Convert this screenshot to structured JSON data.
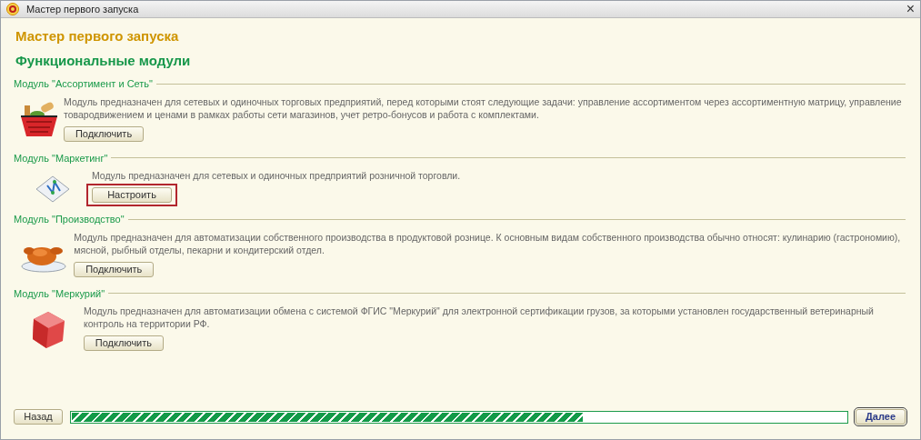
{
  "window": {
    "title": "Мастер первого запуска",
    "close": "×"
  },
  "heading": "Мастер первого запуска",
  "subheading": "Функциональные модули",
  "modules": [
    {
      "title": "Модуль \"Ассортимент и Сеть\"",
      "kind": "basket",
      "description": "Модуль предназначен для сетевых и одиночных торговых предприятий, перед которыми стоят следующие задачи: управление ассортиментом через ассортиментную матрицу, управление товародвижением и ценами в рамках работы сети магазинов, учет ретро-бонусов и работа с комплектами.",
      "button": "Подключить",
      "highlighted": false
    },
    {
      "title": "Модуль \"Маркетинг\"",
      "kind": "diagram",
      "description": "Модуль предназначен для сетевых и одиночных предприятий розничной торговли.",
      "button": "Настроить",
      "highlighted": true
    },
    {
      "title": "Модуль \"Производство\"",
      "kind": "chicken",
      "description": "Модуль предназначен для автоматизации собственного производства в продуктовой рознице. К основным видам собственного производства обычно относят: кулинарию (гастрономию), мясной, рыбный отделы, пекарни и кондитерский отдел.",
      "button": "Подключить",
      "highlighted": false
    },
    {
      "title": "Модуль \"Меркурий\"",
      "kind": "cube",
      "description": "Модуль предназначен для автоматизации обмена с системой ФГИС \"Меркурий\" для электронной сертификации грузов, за которыми установлен государственный ветеринарный контроль на территории РФ.",
      "button": "Подключить",
      "highlighted": false
    }
  ],
  "footer": {
    "back": "Назад",
    "progress": {
      "level": 0.66
    },
    "next": "Далее"
  }
}
